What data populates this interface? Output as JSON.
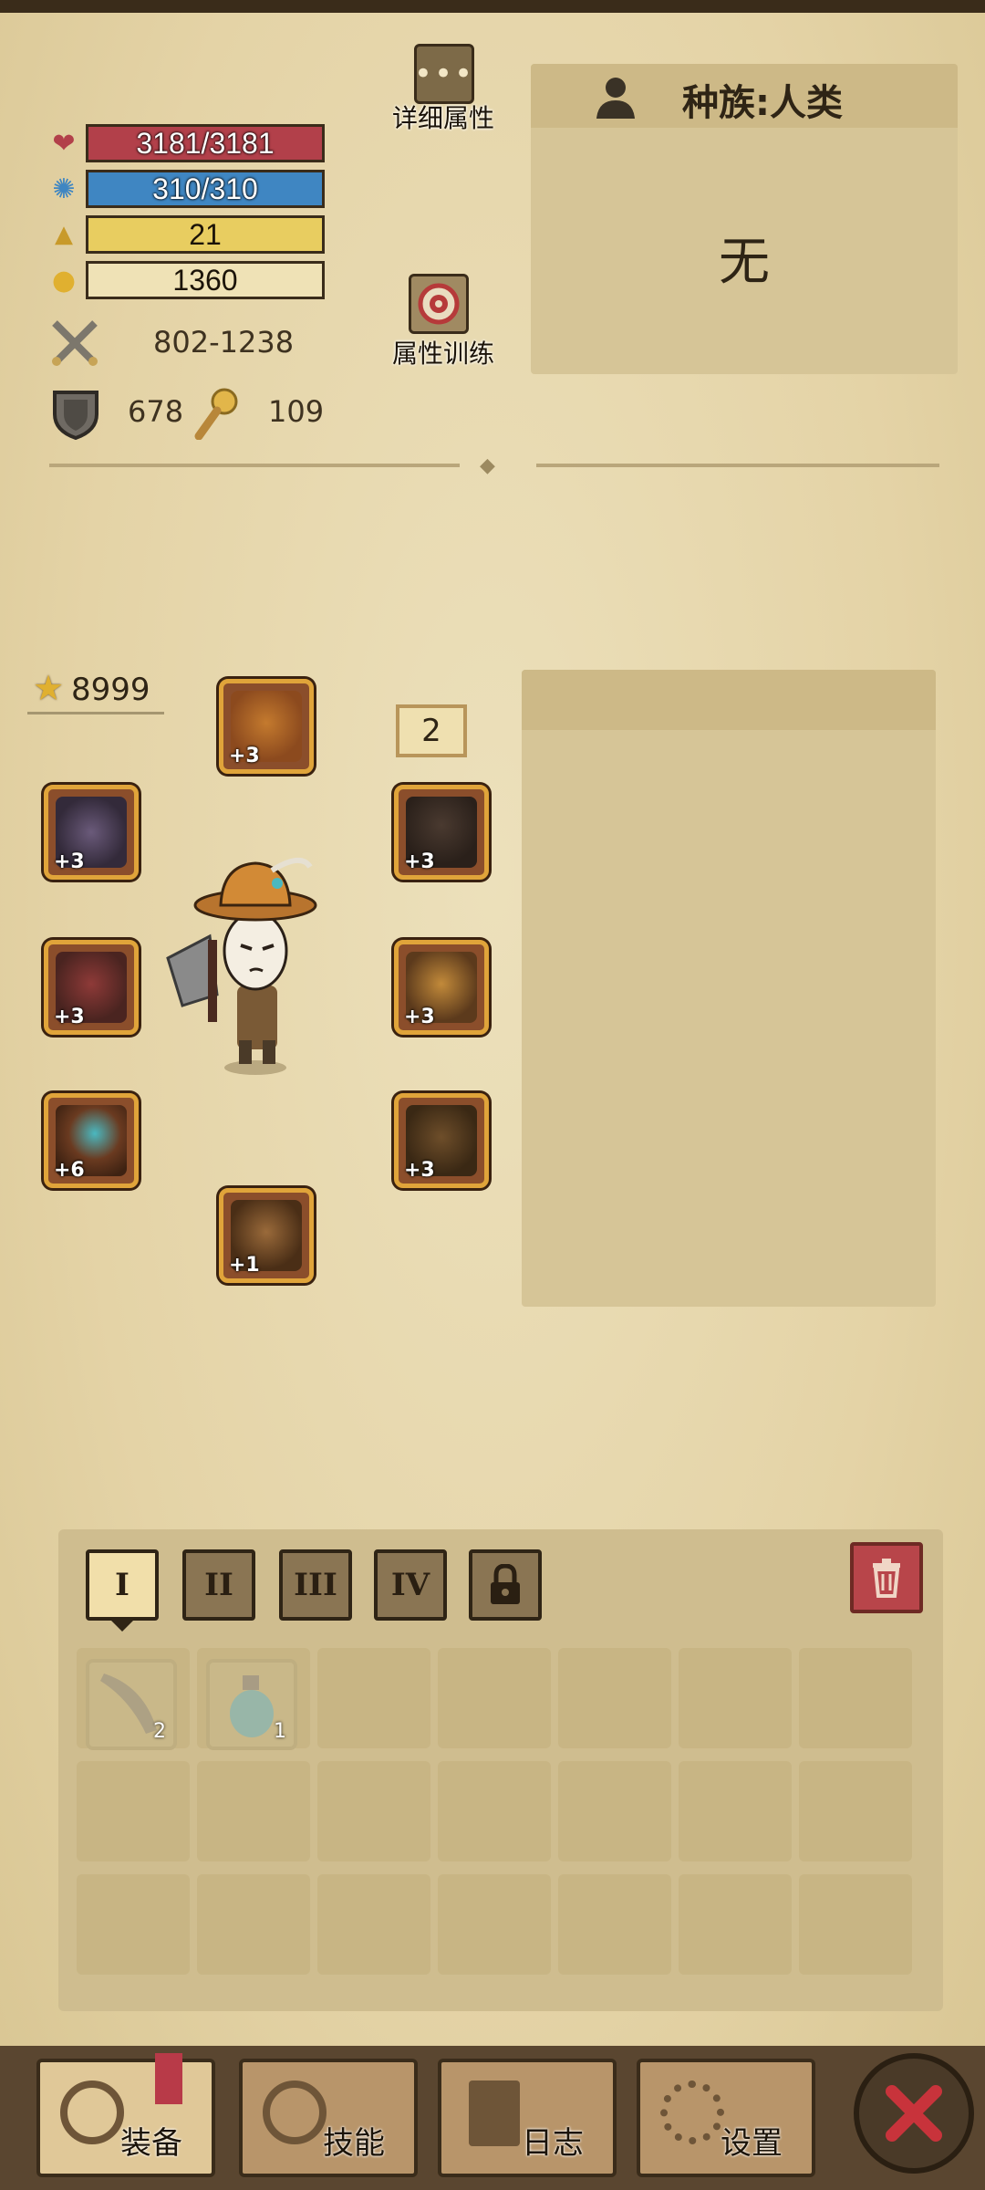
{
  "stats": {
    "hp": "3181/3181",
    "mp": "310/310",
    "level": "21",
    "gold": "1360",
    "attack": "802-1238",
    "defense": "678",
    "magic": "109"
  },
  "buttons": {
    "detail_label": "详细属性",
    "train_label": "属性训练"
  },
  "race": {
    "label": "种族:人类",
    "value": "无"
  },
  "equipment": {
    "star_rating": "8999",
    "badge": "2",
    "slots": [
      {
        "name": "hat",
        "level": "+3"
      },
      {
        "name": "shield",
        "level": "+3"
      },
      {
        "name": "necklace",
        "level": "+3"
      },
      {
        "name": "weapon",
        "level": "+3"
      },
      {
        "name": "armor",
        "level": "+3"
      },
      {
        "name": "ring",
        "level": "+6"
      },
      {
        "name": "pants",
        "level": "+3"
      },
      {
        "name": "boots",
        "level": "+1"
      }
    ]
  },
  "inventory": {
    "tabs": [
      "I",
      "II",
      "III",
      "IV"
    ],
    "items": [
      {
        "name": "blade",
        "count": "2"
      },
      {
        "name": "potion",
        "count": "1"
      }
    ]
  },
  "nav": {
    "equip": "装备",
    "skills": "技能",
    "log": "日志",
    "settings": "设置"
  },
  "colors": {
    "hp": "#b2404a",
    "mp": "#3f86c2",
    "level": "#e8cd60",
    "slot_border": "#e0a43a",
    "close": "#c8333b"
  }
}
